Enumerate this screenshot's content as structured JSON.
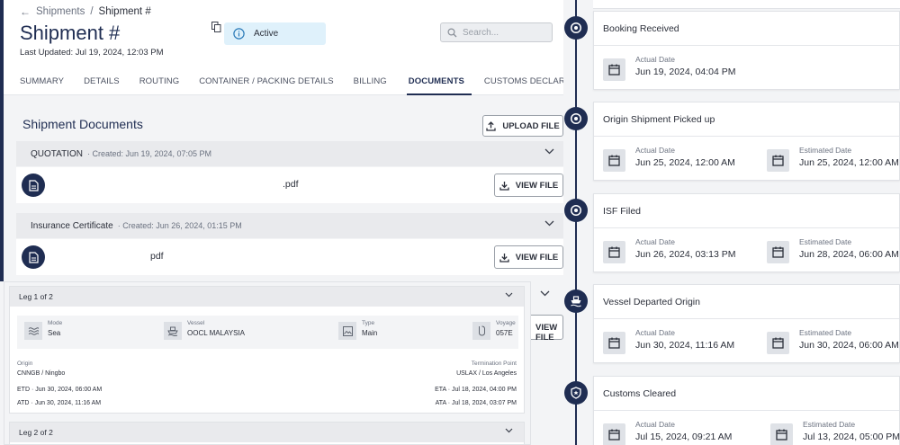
{
  "breadcrumb": {
    "back": "Shipments",
    "separator": "/",
    "current": "Shipment #"
  },
  "shipment": {
    "title": "Shipment #",
    "last_updated": "Last Updated: Jul 19, 2024, 12:03 PM",
    "status": "Active"
  },
  "search": {
    "placeholder": "Search..."
  },
  "tabs": [
    {
      "label": "SUMMARY"
    },
    {
      "label": "DETAILS"
    },
    {
      "label": "ROUTING"
    },
    {
      "label": "CONTAINER / PACKING DETAILS"
    },
    {
      "label": "BILLING"
    },
    {
      "label": "DOCUMENTS"
    },
    {
      "label": "CUSTOMS DECLARATION"
    }
  ],
  "documents": {
    "title": "Shipment Documents",
    "upload_label": "UPLOAD FILE",
    "view_label": "VIEW FILE",
    "hidden_view_label": "VIEW FILE",
    "items": [
      {
        "name": "QUOTATION",
        "created": "Created: Jun 19, 2024, 07:05 PM",
        "file": ".pdf"
      },
      {
        "name": "Insurance Certificate",
        "created": "Created: Jun 26, 2024, 01:15 PM",
        "file": "pdf"
      }
    ]
  },
  "routing": {
    "legs": [
      {
        "title": "Leg 1 of 2",
        "mode_label": "Mode",
        "mode": "Sea",
        "vessel_label": "Vessel",
        "vessel": "OOCL MALAYSIA",
        "type_label": "Type",
        "type": "Main",
        "voyage_label": "Voyage",
        "voyage": "057E",
        "origin_label": "Origin",
        "origin": "CNNGB / Ningbo",
        "termination_label": "Termination Point",
        "termination": "USLAX / Los Angeles",
        "etd": "ETD · Jun 30, 2024, 06:00 AM",
        "atd": "ATD · Jun 30, 2024, 11:16 AM",
        "eta": "ETA · Jul 18, 2024, 04:00 PM",
        "ata": "ATA · Jul 18, 2024, 03:07 PM"
      },
      {
        "title": "Leg 2 of 2"
      }
    ]
  },
  "timeline": {
    "actual_label": "Actual Date",
    "estimated_label": "Estimated Date",
    "events": [
      {
        "title": "Booking Received",
        "icon": "target-icon",
        "actual": "Jun 19, 2024, 04:04 PM"
      },
      {
        "title": "Origin Shipment Picked up",
        "icon": "target-icon",
        "actual": "Jun 25, 2024, 12:00 AM",
        "estimated": "Jun 25, 2024, 12:00 AM"
      },
      {
        "title": "ISF Filed",
        "icon": "target-icon",
        "actual": "Jun 26, 2024, 03:13 PM",
        "estimated": "Jun 28, 2024, 06:00 AM"
      },
      {
        "title": "Vessel Departed Origin",
        "icon": "ship-icon",
        "actual": "Jun 30, 2024, 11:16 AM",
        "estimated": "Jun 30, 2024, 06:00 AM"
      },
      {
        "title": "Customs Cleared",
        "icon": "badge-icon",
        "actual": "Jul 15, 2024, 09:21 AM",
        "estimated": "Jul 13, 2024, 05:00 PM"
      }
    ]
  },
  "colors": {
    "primary": "#1f2d52",
    "status_bg": "#dff1fb",
    "panel_bg": "#f3f4f6"
  }
}
